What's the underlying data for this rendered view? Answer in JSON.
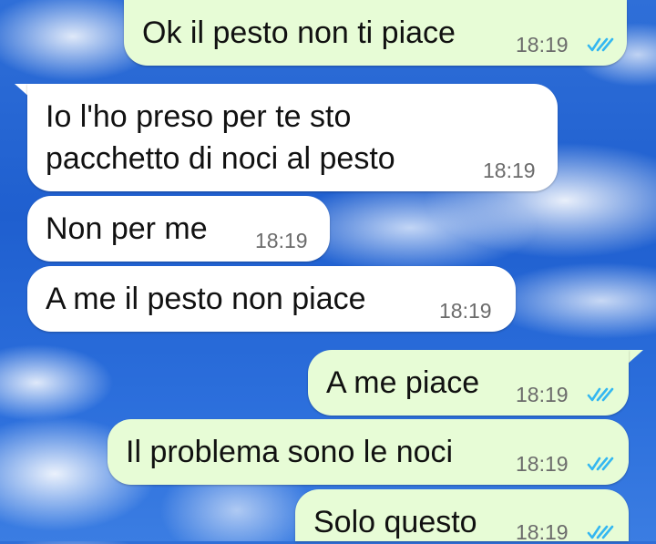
{
  "messages": [
    {
      "text": "Ok il pesto non ti piace",
      "time": "18:19",
      "direction": "outgoing",
      "status": "read"
    },
    {
      "text_line1": "Io l'ho preso per te sto",
      "text_line2": "pacchetto di noci al pesto",
      "time": "18:19",
      "direction": "incoming"
    },
    {
      "text": "Non per me",
      "time": "18:19",
      "direction": "incoming"
    },
    {
      "text": "A me il pesto non piace",
      "time": "18:19",
      "direction": "incoming"
    },
    {
      "text": "A me piace",
      "time": "18:19",
      "direction": "outgoing",
      "status": "read"
    },
    {
      "text": "Il problema sono le noci",
      "time": "18:19",
      "direction": "outgoing",
      "status": "read"
    },
    {
      "text": "Solo questo",
      "time": "18:19",
      "direction": "outgoing",
      "status": "read"
    }
  ],
  "colors": {
    "outgoing_bubble": "#e7fcd6",
    "incoming_bubble": "#ffffff",
    "read_ticks": "#34b7f1",
    "timestamp": "#6b6b6b"
  },
  "icons": [
    "double-check-icon"
  ]
}
